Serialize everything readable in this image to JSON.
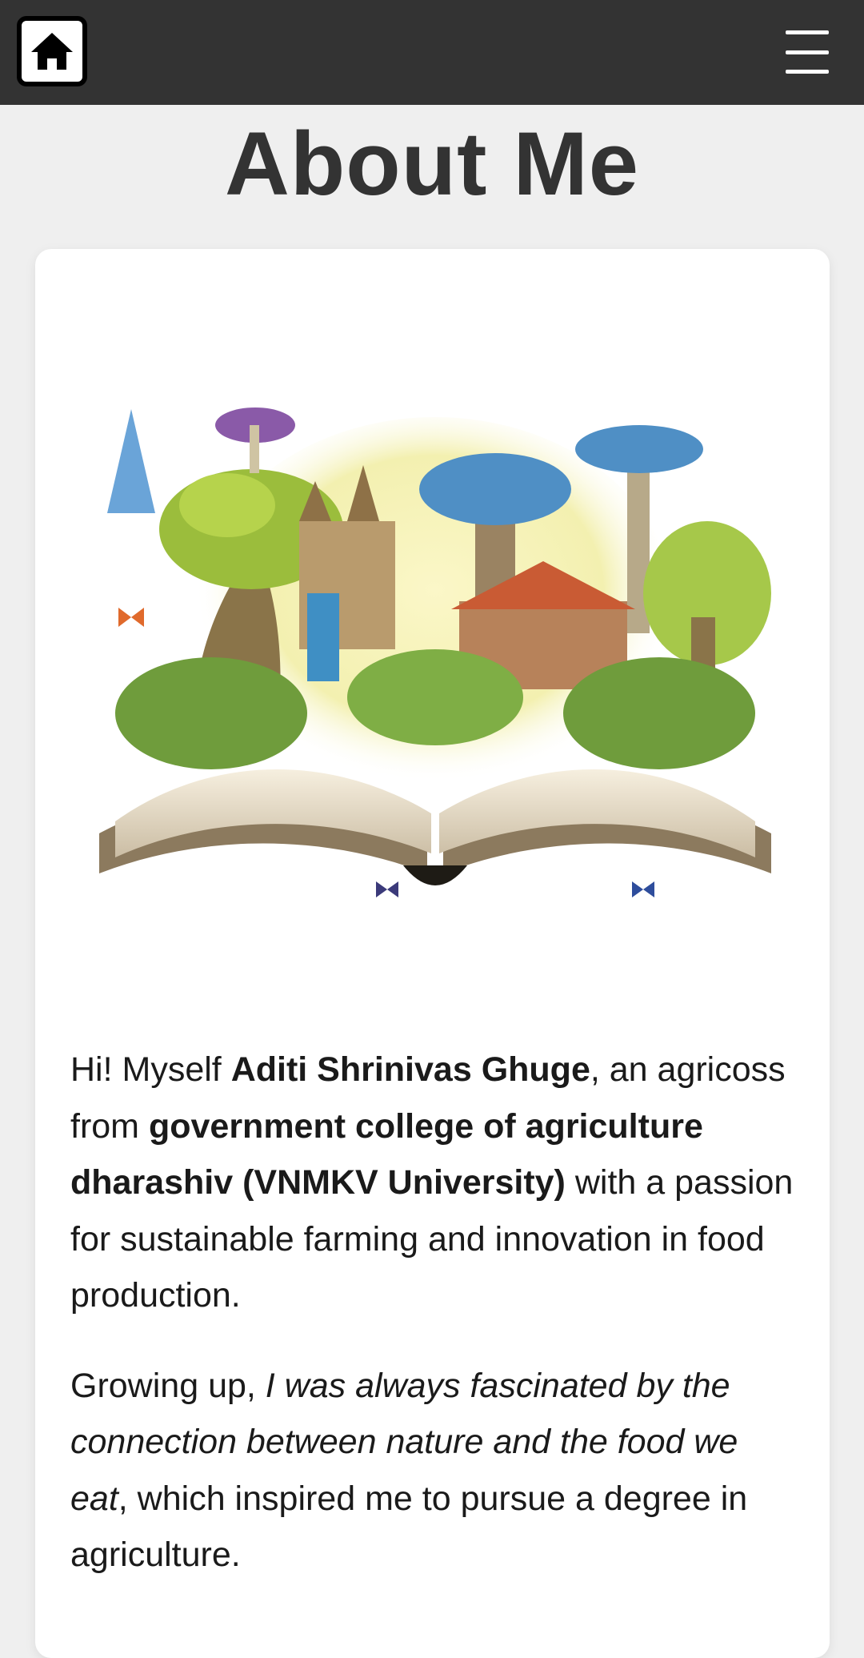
{
  "header": {
    "home_icon": "home-icon",
    "menu_icon": "hamburger-menu-icon",
    "background_color": "#333333"
  },
  "page": {
    "title": "About Me"
  },
  "card": {
    "image_description_icon": "open-book-fantasy-illustration",
    "paragraph1": {
      "part1": "Hi! Myself ",
      "name": "Aditi Shrinivas Ghuge",
      "part2": ", an agricoss from ",
      "college": "government college of agriculture dharashiv (VNMKV University)",
      "part3": " with a passion for sustainable farming and innovation in food production."
    },
    "paragraph2": {
      "part1": "Growing up, ",
      "italic": "I was always fascinated by the connection between nature and the food we eat",
      "part2": ", which inspired me to pursue a degree in agriculture."
    }
  }
}
